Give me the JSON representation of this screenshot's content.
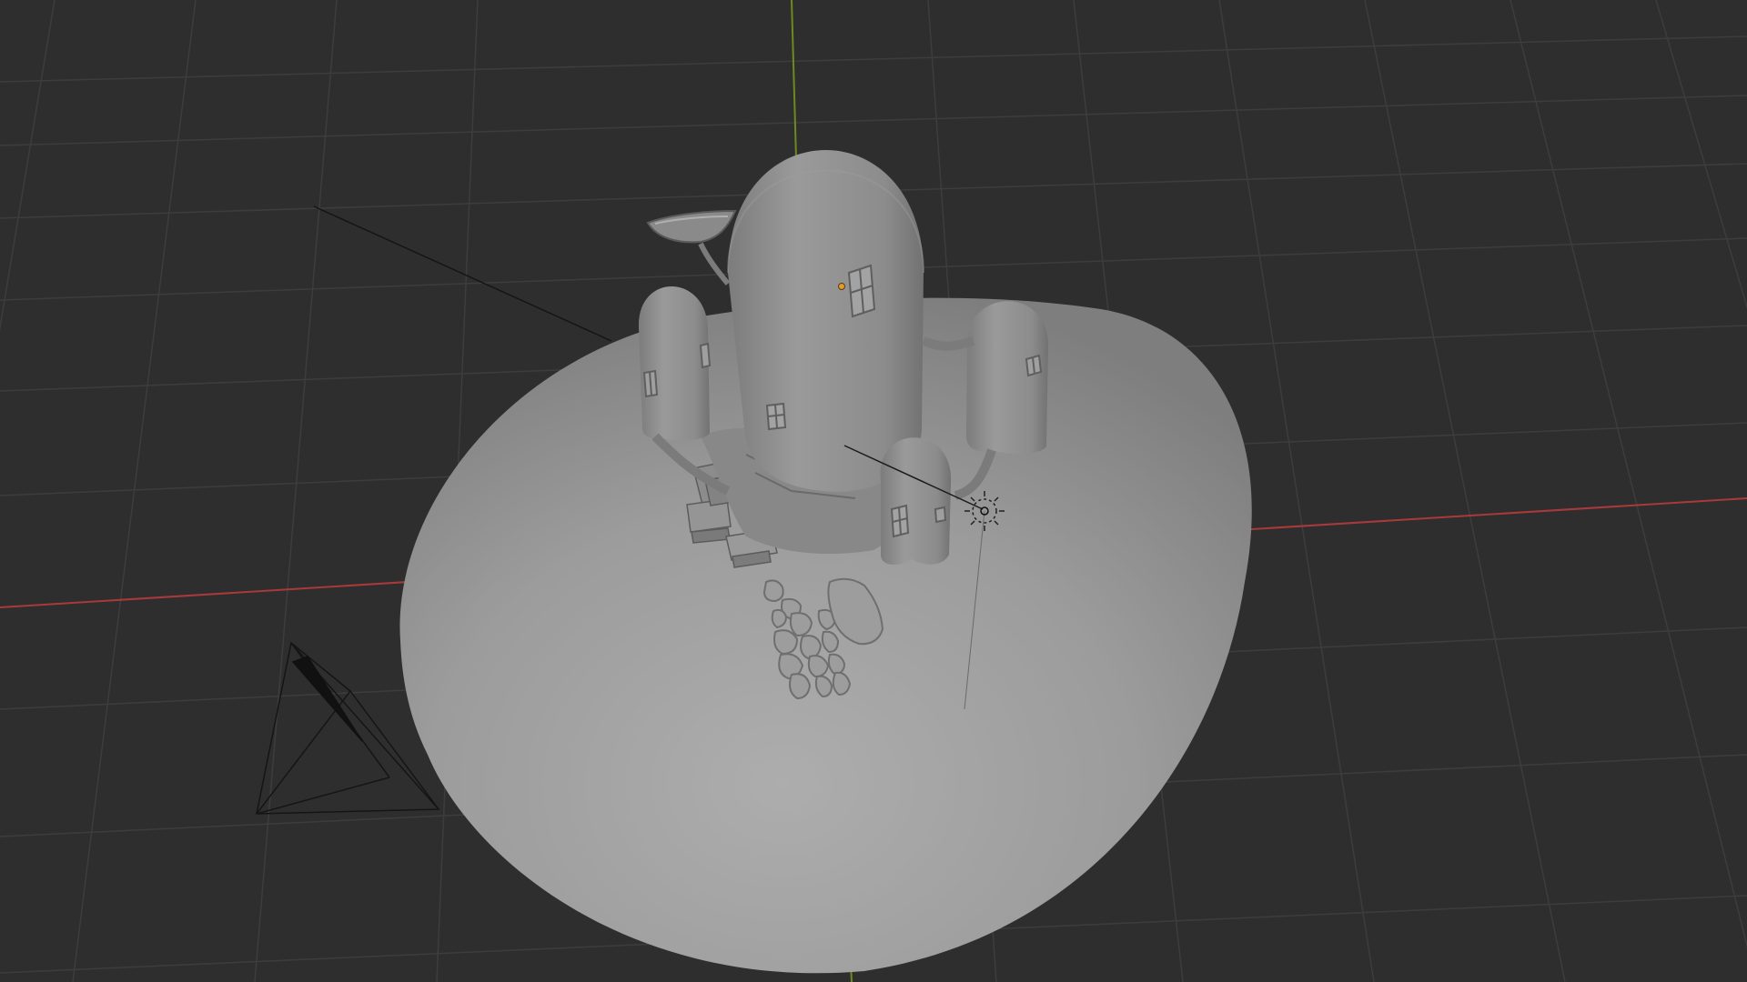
{
  "app": "Blender",
  "viewport": {
    "mode": "solid",
    "background": "#2e2e2e",
    "grid_color": "#3c3c3c",
    "axis_x_color": "#a83a3a",
    "axis_y_color": "#6e8a1e"
  },
  "scene": {
    "objects": [
      {
        "name": "ground-dome",
        "type": "mesh",
        "shading": "clay",
        "color": "#9a9a9a"
      },
      {
        "name": "main-tower",
        "type": "mesh",
        "color": "#8f8f8f"
      },
      {
        "name": "left-tower",
        "type": "mesh",
        "color": "#8d8d8d"
      },
      {
        "name": "right-tower",
        "type": "mesh",
        "color": "#8d8d8d"
      },
      {
        "name": "front-tower",
        "type": "mesh",
        "color": "#8f8f8f"
      },
      {
        "name": "stone-path",
        "type": "mesh",
        "color": "#8a8a8a"
      },
      {
        "name": "crate-stack",
        "type": "mesh",
        "color": "#8c8c8c"
      },
      {
        "name": "boat-balcony",
        "type": "mesh",
        "color": "#8e8e8e"
      },
      {
        "name": "camera",
        "type": "camera",
        "icon": "camera-icon"
      },
      {
        "name": "light",
        "type": "light",
        "icon": "sun-light-icon"
      }
    ]
  }
}
